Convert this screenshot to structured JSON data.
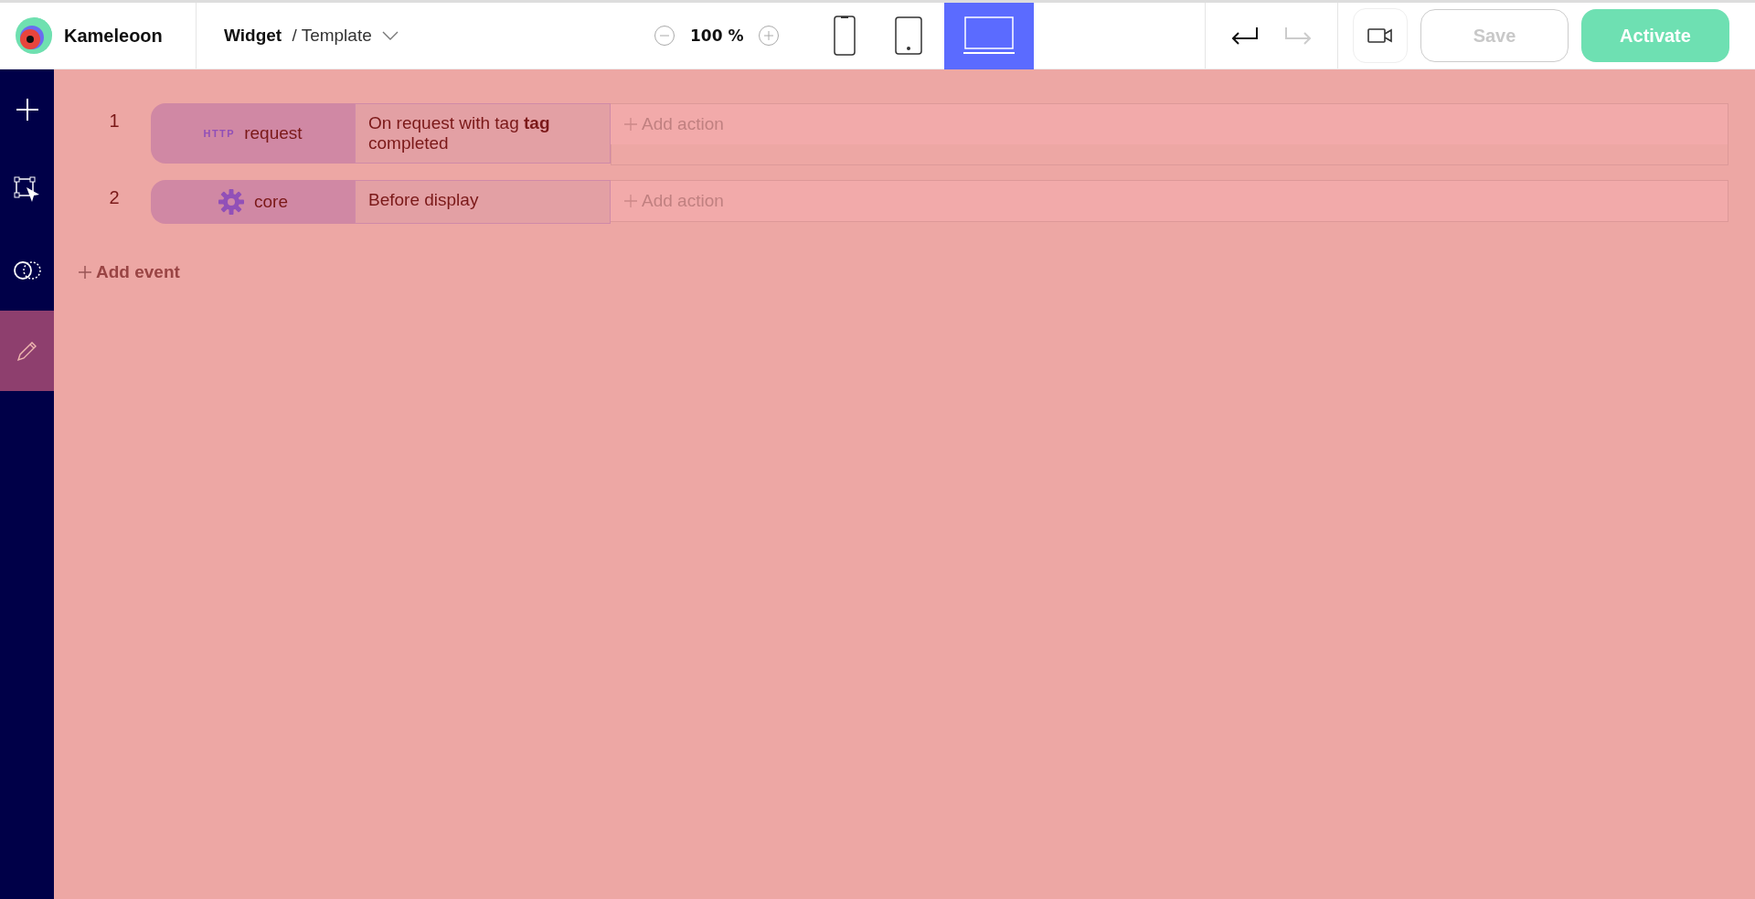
{
  "brand": {
    "name": "Kameleoon"
  },
  "breadcrumb": {
    "type": "Widget",
    "separator": "/",
    "name": "Template"
  },
  "zoom": {
    "value": "100 %"
  },
  "devices": [
    {
      "kind": "phone",
      "selected": false
    },
    {
      "kind": "tablet",
      "selected": false
    },
    {
      "kind": "desktop",
      "selected": true
    }
  ],
  "history": [
    {
      "kind": "undo",
      "disabled": false
    },
    {
      "kind": "redo",
      "disabled": true
    }
  ],
  "actions": [
    {
      "kind": "record"
    },
    {
      "kind": "save",
      "label": "Save",
      "disabled": true
    },
    {
      "kind": "activate",
      "label": "Activate",
      "disabled": false
    }
  ],
  "sidebar": {
    "items": [
      {
        "kind": "add",
        "selected": false
      },
      {
        "kind": "select",
        "selected": false
      },
      {
        "kind": "segments",
        "selected": false
      },
      {
        "kind": "edit",
        "selected": true
      }
    ]
  },
  "events": [
    {
      "number": "1",
      "kind": "http",
      "badge": "HTTP",
      "source": "request",
      "condition": "On request with tag **tag** completed",
      "action_placeholder": "Add action"
    },
    {
      "number": "2",
      "kind": "core",
      "source": "core",
      "condition": "Before display",
      "action_placeholder": "Add action"
    }
  ],
  "add_event": "Add event"
}
